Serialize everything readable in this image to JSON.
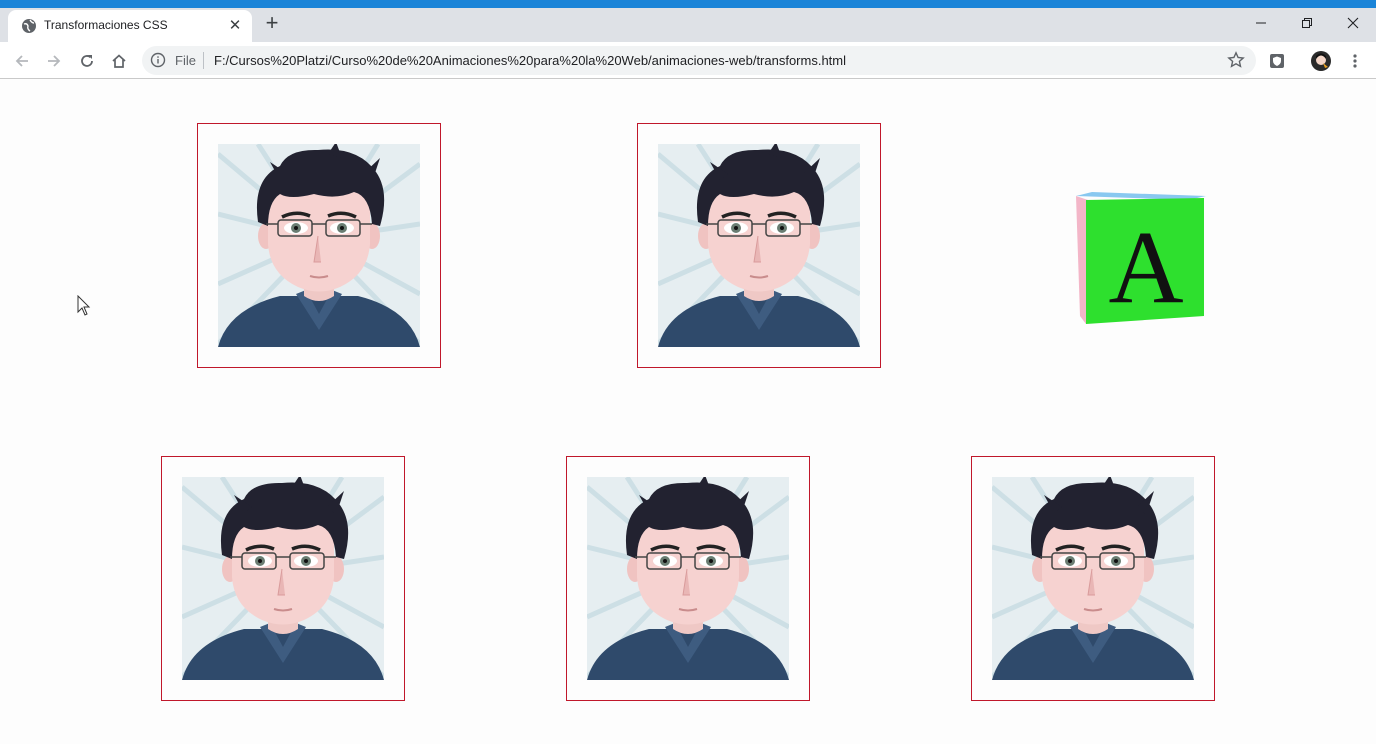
{
  "browser": {
    "tab_title": "Transformaciones CSS",
    "tab_close_glyph": "✕",
    "new_tab_glyph": "+",
    "file_label": "File",
    "url": "F:/Cursos%20Platzi/Curso%20de%20Animaciones%20para%20la%20Web/animaciones-web/transforms.html",
    "icons": [
      "globe-icon",
      "back-icon",
      "forward-icon",
      "reload-icon",
      "home-icon",
      "info-icon",
      "star-icon",
      "extension-icon",
      "profile-icon",
      "menu-icon",
      "minimize-icon",
      "restore-icon",
      "close-icon"
    ]
  },
  "page": {
    "cube_letter": "A",
    "cube_colors": {
      "front": "#2ee02e",
      "left": "#f3b6c8",
      "top": "#89c8f0"
    },
    "card_border_color": "#c0182b",
    "cards": [
      {
        "name": "card-1",
        "label": "avatar"
      },
      {
        "name": "card-2",
        "label": "avatar"
      },
      {
        "name": "card-3",
        "label": "avatar"
      },
      {
        "name": "card-4",
        "label": "avatar"
      },
      {
        "name": "card-5",
        "label": "avatar"
      }
    ]
  }
}
